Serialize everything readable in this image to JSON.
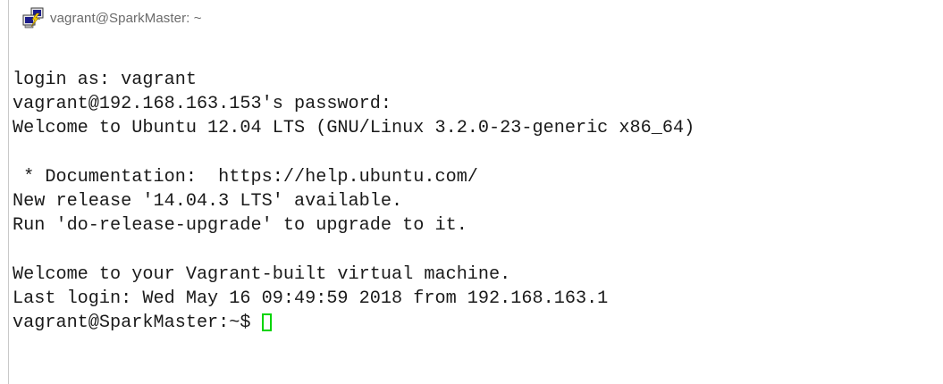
{
  "window": {
    "title": "vagrant@SparkMaster: ~",
    "icon": "putty-icon"
  },
  "terminal": {
    "lines": [
      "login as: vagrant",
      "vagrant@192.168.163.153's password:",
      "Welcome to Ubuntu 12.04 LTS (GNU/Linux 3.2.0-23-generic x86_64)",
      "",
      " * Documentation:  https://help.ubuntu.com/",
      "New release '14.04.3 LTS' available.",
      "Run 'do-release-upgrade' to upgrade to it.",
      "",
      "Welcome to your Vagrant-built virtual machine.",
      "Last login: Wed May 16 09:49:59 2018 from 192.168.163.1"
    ],
    "prompt": "vagrant@SparkMaster:~$",
    "cursor_color": "#00d400"
  }
}
